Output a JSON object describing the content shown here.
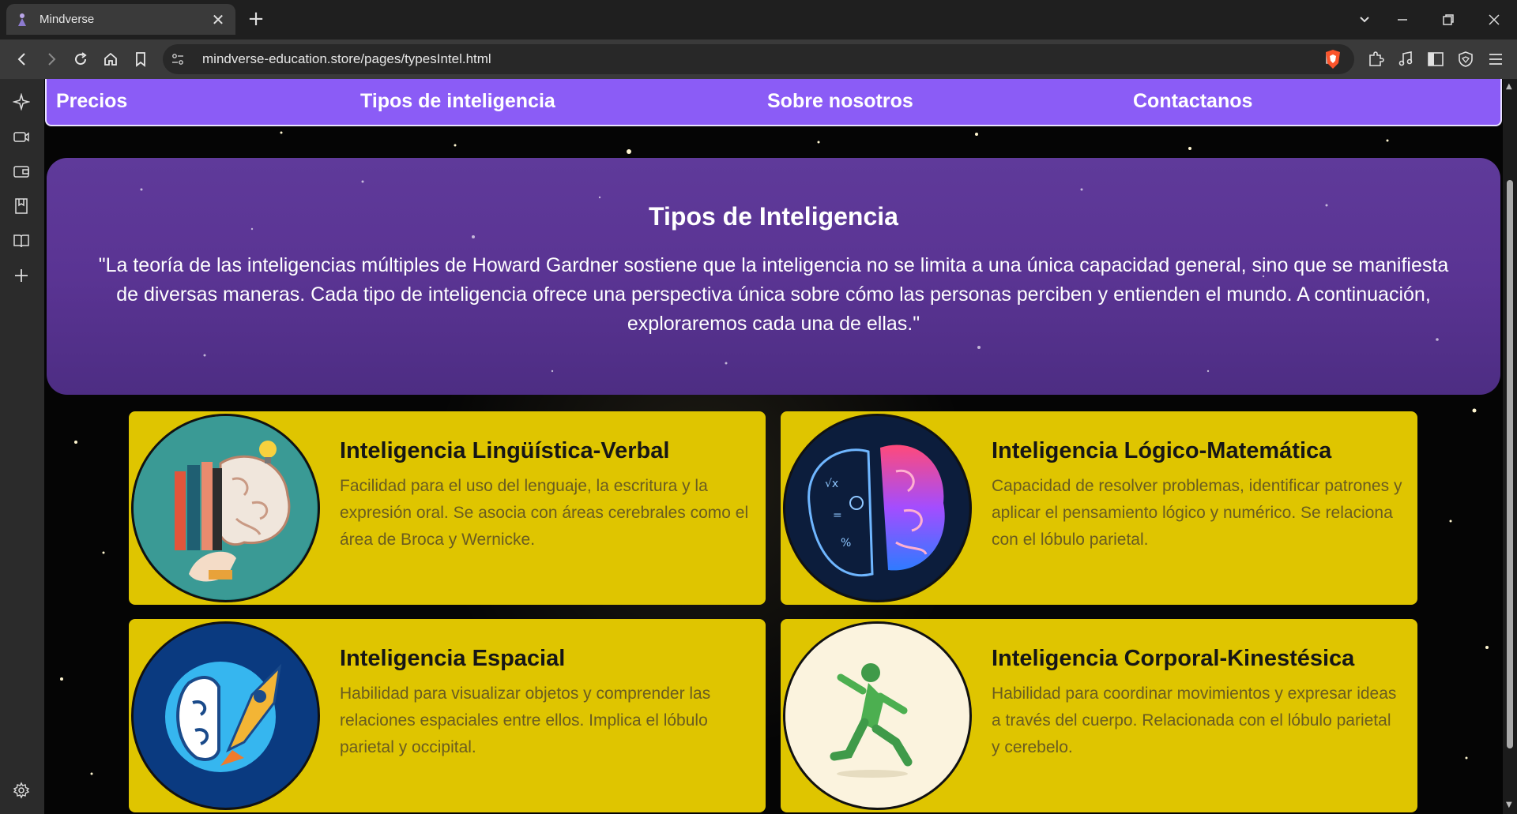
{
  "browser": {
    "tab_title": "Mindverse",
    "url": "mindverse-education.store/pages/typesIntel.html"
  },
  "nav": {
    "items": [
      "Precios",
      "Tipos de inteligencia",
      "Sobre nosotros",
      "Contactanos"
    ]
  },
  "hero": {
    "title": "Tipos de Inteligencia",
    "text": "\"La teoría de las inteligencias múltiples de Howard Gardner sostiene que la inteligencia no se limita a una única capacidad general, sino que se manifiesta de diversas maneras. Cada tipo de inteligencia ofrece una perspectiva única sobre cómo las personas perciben y entienden el mundo. A continuación, exploraremos cada una de ellas.\""
  },
  "cards": [
    {
      "title": "Inteligencia Lingüística-Verbal",
      "text": "Facilidad para el uso del lenguaje, la escritura y la expresión oral. Se asocia con áreas cerebrales como el área de Broca y Wernicke.",
      "icon": "brain-books-icon"
    },
    {
      "title": "Inteligencia Lógico-Matemática",
      "text": "Capacidad de resolver problemas, identificar patrones y aplicar el pensamiento lógico y numérico. Se relaciona con el lóbulo parietal.",
      "icon": "brain-math-icon"
    },
    {
      "title": "Inteligencia Espacial",
      "text": "Habilidad para visualizar objetos y comprender las relaciones espaciales entre ellos. Implica el lóbulo parietal y occipital.",
      "icon": "brain-rocket-icon"
    },
    {
      "title": "Inteligencia Corporal-Kinestésica",
      "text": "Habilidad para coordinar movimientos y expresar ideas a través del cuerpo. Relacionada con el lóbulo parietal y cerebelo.",
      "icon": "running-child-icon"
    }
  ],
  "colors": {
    "nav_bg": "#8b5cf6",
    "hero_bg": "#5a3493",
    "card_bg": "#dfc500",
    "page_bg": "#050505"
  }
}
